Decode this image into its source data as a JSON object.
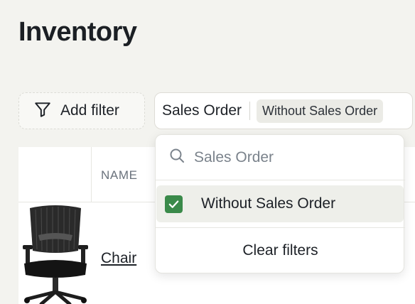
{
  "page": {
    "title": "Inventory"
  },
  "filters": {
    "add_filter_label": "Add filter",
    "active_filter": {
      "field": "Sales Order",
      "value": "Without Sales Order"
    }
  },
  "table": {
    "columns": [
      "",
      "NAME"
    ],
    "rows": [
      {
        "image": "office-chair-photo",
        "name": "Chair"
      }
    ]
  },
  "dropdown": {
    "search_placeholder": "Sales Order",
    "options": [
      {
        "label": "Without Sales Order",
        "checked": true
      }
    ],
    "clear_label": "Clear filters"
  },
  "colors": {
    "background": "#f3f3ef",
    "checkbox_checked": "#3a8a4a",
    "selected_option_bg": "#eeefea"
  },
  "icons": {
    "filter": "funnel-icon",
    "search": "search-icon",
    "check": "check-icon"
  }
}
